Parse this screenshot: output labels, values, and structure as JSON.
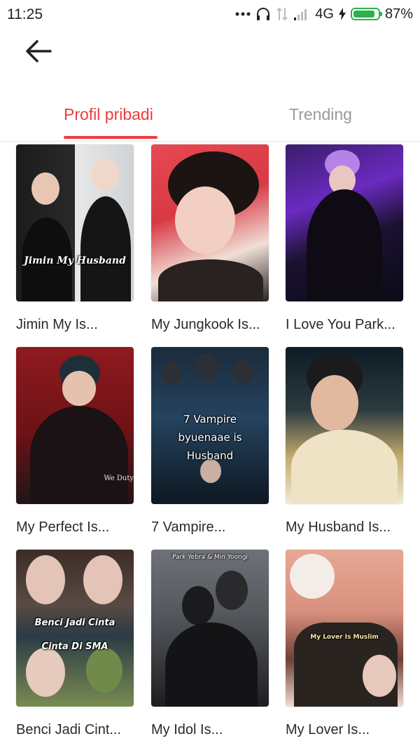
{
  "status_bar": {
    "time": "11:25",
    "network": "4G",
    "battery_percent": "87%",
    "battery_level": 0.87
  },
  "header": {
    "back_icon": "arrow-left-icon"
  },
  "tabs": [
    {
      "label": "Profil pribadi",
      "active": true
    },
    {
      "label": "Trending",
      "active": false
    }
  ],
  "colors": {
    "accent": "#ef3b3b",
    "inactive_tab": "#9a9a9a",
    "battery": "#2bb24c"
  },
  "books": [
    {
      "title": "Jimin My Is...",
      "cover_text": "Jimin My Husband"
    },
    {
      "title": "My Jungkook Is...",
      "cover_text": ""
    },
    {
      "title": "I Love You Park...",
      "cover_text": ""
    },
    {
      "title": "My Perfect Is...",
      "cover_text": "We Duty"
    },
    {
      "title": "7 Vampire...",
      "cover_text": "7 Vampire byuenaae is Husband"
    },
    {
      "title": "My Husband Is...",
      "cover_text": ""
    },
    {
      "title": "Benci Jadi Cint...",
      "cover_text": "Benci Jadi Cinta Cinta Di SMA"
    },
    {
      "title": "My Idol Is...",
      "cover_text": "Park Yebra & Min Yoongi"
    },
    {
      "title": "My Lover Is...",
      "cover_text": "My Lover Is Muslim"
    }
  ]
}
